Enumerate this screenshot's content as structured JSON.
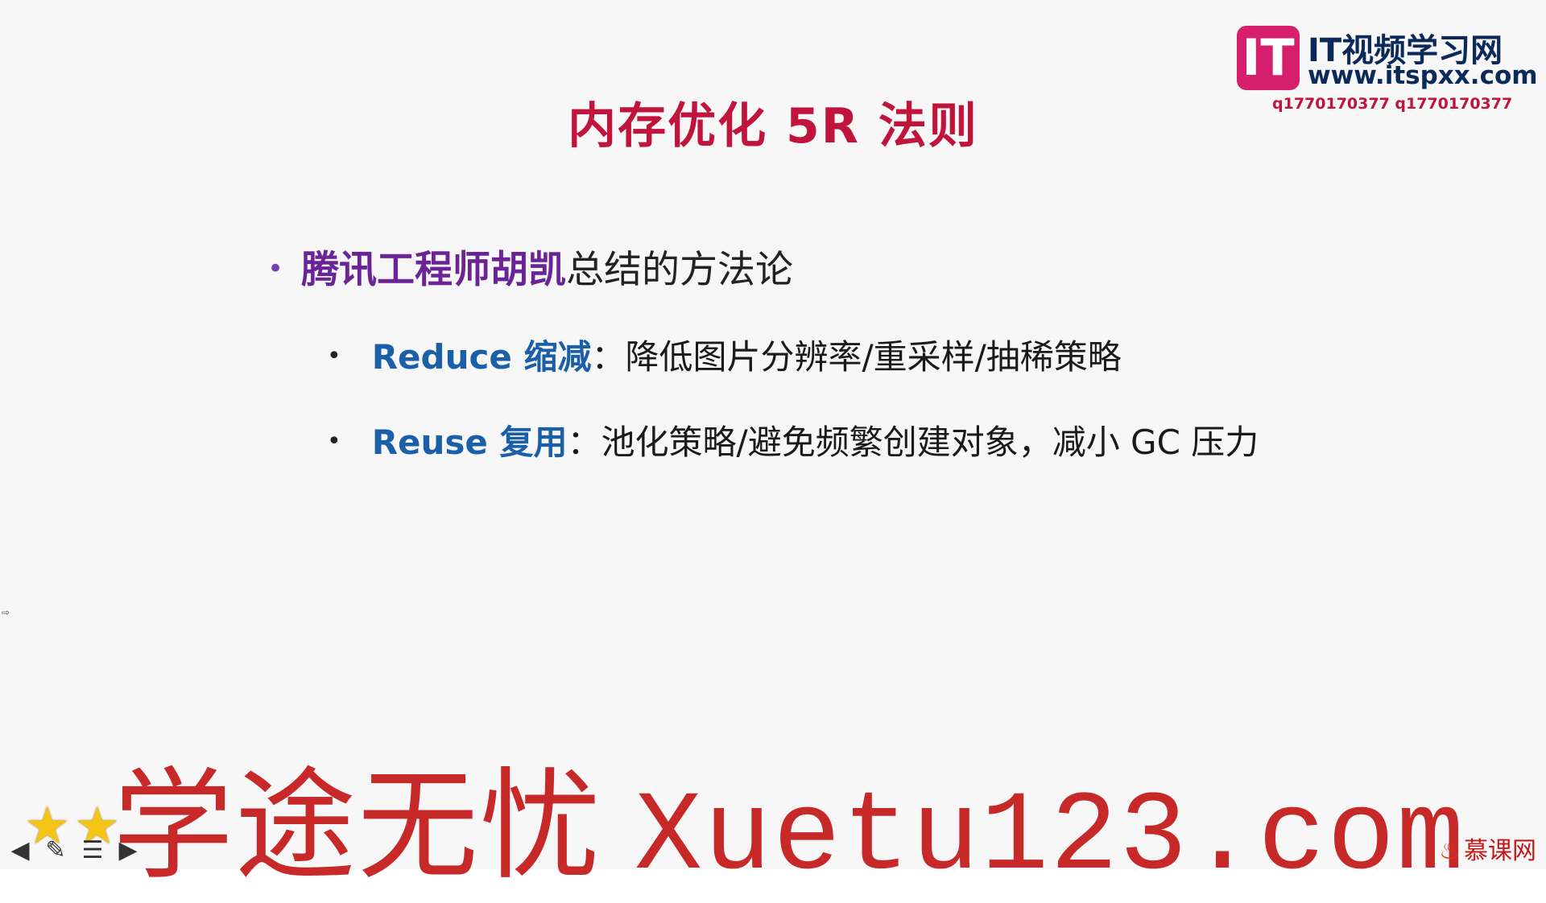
{
  "slide": {
    "title": "内存优化 5R 法则",
    "bullet_main": {
      "bullet": "•",
      "highlight": "腾讯工程师胡凯",
      "rest": "总结的方法论"
    },
    "sub_bullets": [
      {
        "bullet": "•",
        "keyword": "Reduce 缩减",
        "text": "：降低图片分辨率/重采样/抽稀策略"
      },
      {
        "bullet": "•",
        "keyword": "Reuse 复用",
        "text": "：池化策略/避免频繁创建对象，减小 GC 压力"
      }
    ]
  },
  "logo": {
    "mark": "IT",
    "title": "IT视频学习网",
    "url": "www.itspxx.com",
    "qq": "q1770170377 q1770170377"
  },
  "watermark": {
    "cn": "学途无忧",
    "url": "Xuetu123.com"
  },
  "footer": {
    "mooc": "慕课网",
    "icons": [
      "star-icon",
      "star-icon",
      "arrow-left-icon",
      "pencil-icon",
      "menu-icon",
      "arrow-right-icon"
    ]
  },
  "colors": {
    "title": "#c0143c",
    "highlight": "#6a2496",
    "keyword": "#1b5fa8",
    "watermark": "#c41818"
  }
}
